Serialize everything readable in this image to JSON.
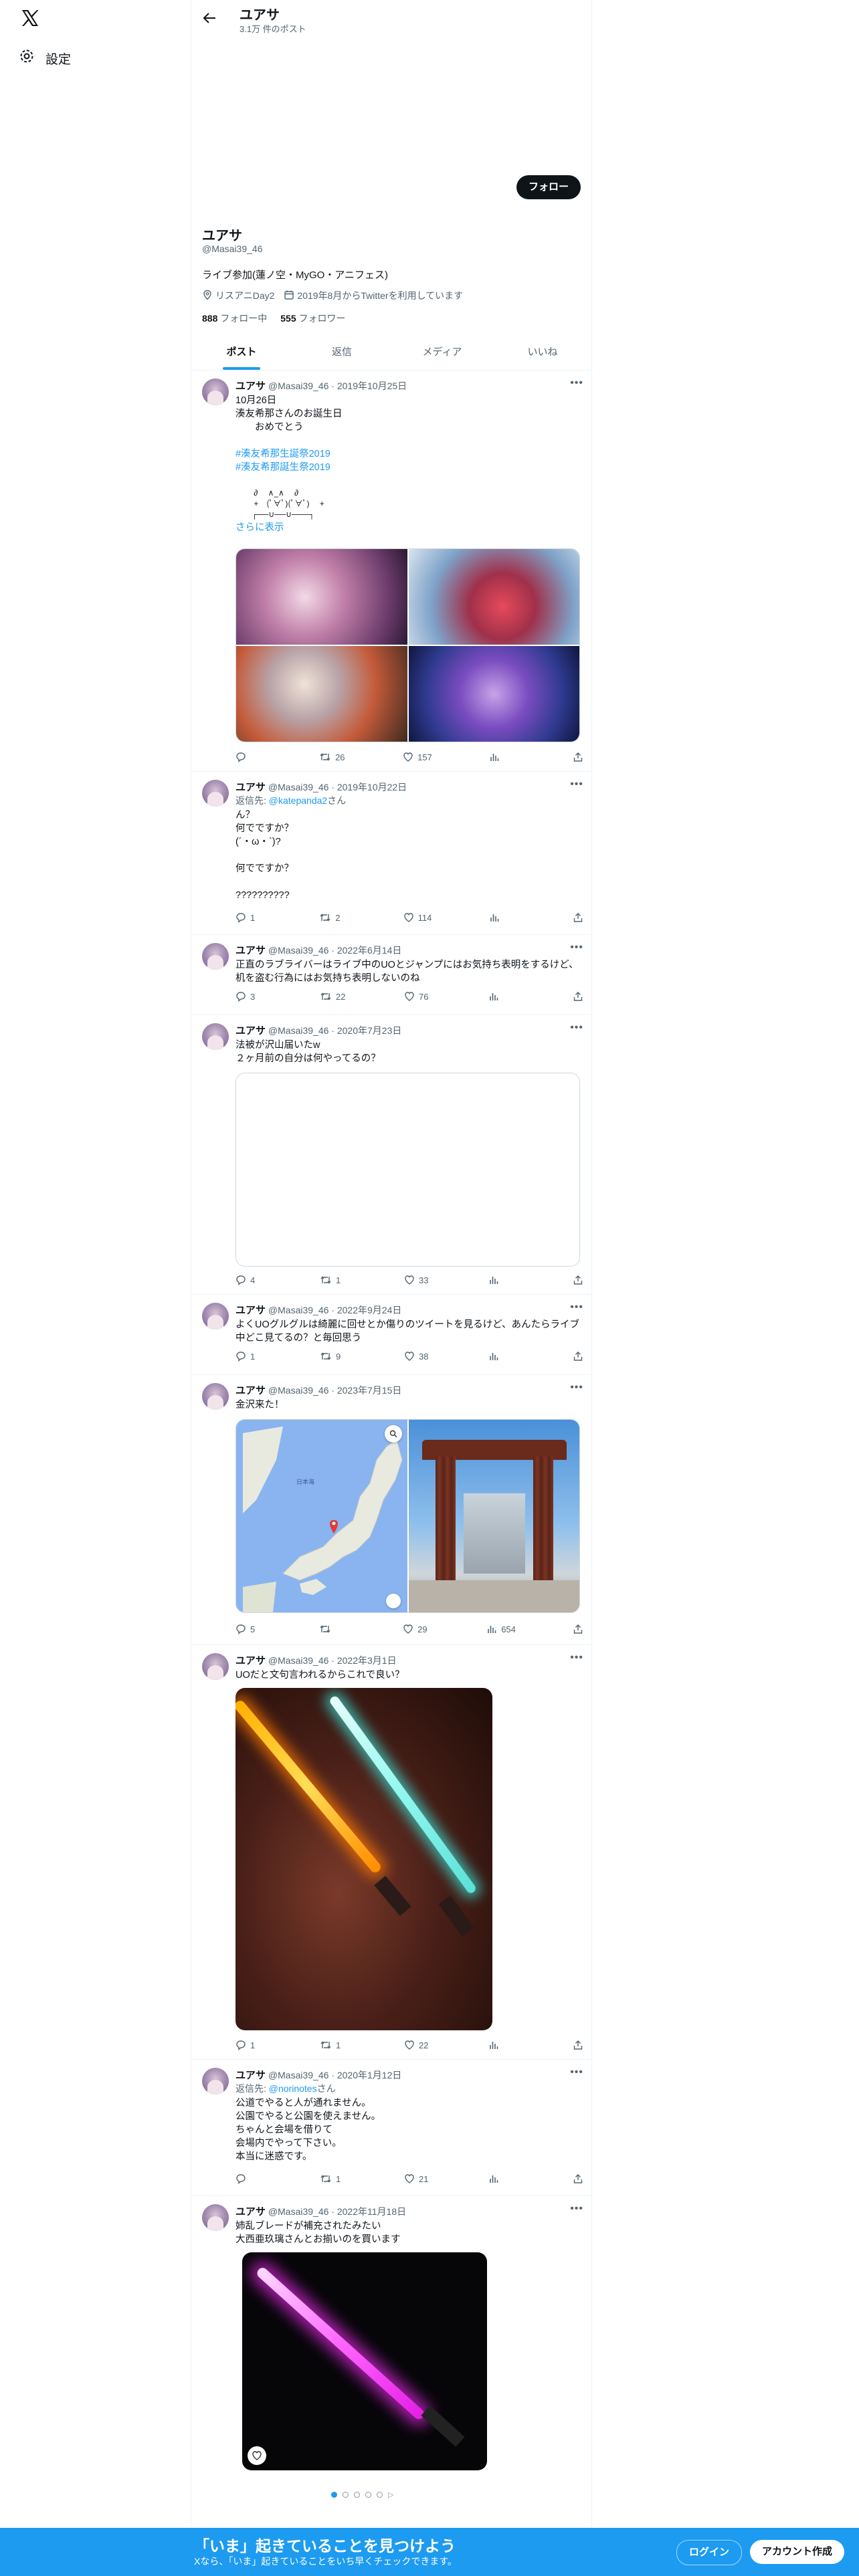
{
  "sidebar": {
    "settings_label": "設定"
  },
  "topbar": {
    "name": "ユアサ",
    "post_count": "3.1万 件のポスト"
  },
  "profile": {
    "follow_label": "フォロー",
    "name": "ユアサ",
    "handle": "@Masai39_46",
    "bio": "ライブ参加(蓮ノ空・MyGO・アニフェス)",
    "location": "リスアニDay2",
    "joined": "2019年8月からTwitterを利用しています",
    "following_count": "888",
    "following_label": "フォロー中",
    "followers_count": "555",
    "followers_label": "フォロワー"
  },
  "tabs": [
    "ポスト",
    "返信",
    "メディア",
    "いいね"
  ],
  "tweets": [
    {
      "name": "ユアサ",
      "handle": "@Masai39_46",
      "date": "2019年10月25日",
      "text": "10月26日\n湊友希那さんのお誕生日\n　　おめでとう",
      "hashtags": [
        "#湊友希那生誕祭2019",
        "#湊友希那誕生祭2019"
      ],
      "art": "　　 ∂　 ∧_∧ 　∂\n　　 +　(ﾟ∀ﾟ)(ﾟ∀ﾟ) 　+\n　　┌──∪──∪───┐",
      "show_more": "さらに表示",
      "reply": "",
      "retweet": "26",
      "like": "157",
      "views": ""
    },
    {
      "name": "ユアサ",
      "handle": "@Masai39_46",
      "date": "2019年10月22日",
      "reply_prefix": "返信先:",
      "reply_to": "@katepanda2",
      "reply_suffix": "さん",
      "text": "ん？\n何でですか？\n(´・ω・`)?\n\n何でですか？\n\n??????????",
      "reply": "1",
      "retweet": "2",
      "like": "114",
      "views": ""
    },
    {
      "name": "ユアサ",
      "handle": "@Masai39_46",
      "date": "2022年6月14日",
      "text": "正直のラブライバーはライブ中のUOとジャンプにはお気持ち表明をするけど、机を盗む行為にはお気持ち表明しないのね",
      "reply": "3",
      "retweet": "22",
      "like": "76",
      "views": ""
    },
    {
      "name": "ユアサ",
      "handle": "@Masai39_46",
      "date": "2020年7月23日",
      "text": "法被が沢山届いたw\n２ヶ月前の自分は何やってるの？",
      "reply": "4",
      "retweet": "1",
      "like": "33",
      "views": ""
    },
    {
      "name": "ユアサ",
      "handle": "@Masai39_46",
      "date": "2022年9月24日",
      "text": "よくUOグルグルは綺麗に回せとか傷りのツイートを見るけど、あんたらライブ中どこ見てるの？と毎回思う",
      "reply": "1",
      "retweet": "9",
      "like": "38",
      "views": ""
    },
    {
      "name": "ユアサ",
      "handle": "@Masai39_46",
      "date": "2023年7月15日",
      "text": "金沢来た！",
      "reply": "5",
      "retweet": "",
      "like": "29",
      "views": "654"
    },
    {
      "name": "ユアサ",
      "handle": "@Masai39_46",
      "date": "2022年3月1日",
      "text": "UOだと文句言われるからこれで良い？",
      "reply": "1",
      "retweet": "1",
      "like": "22",
      "views": ""
    },
    {
      "name": "ユアサ",
      "handle": "@Masai39_46",
      "date": "2020年1月12日",
      "reply_prefix": "返信先:",
      "reply_to": "@norinotes",
      "reply_suffix": "さん",
      "text": "公道でやると人が通れません。\n公園でやると公園を使えません。\nちゃんと会場を借りて\n会場内でやって下さい。\n本当に迷惑です。",
      "reply": "",
      "retweet": "1",
      "like": "21",
      "views": ""
    },
    {
      "name": "ユアサ",
      "handle": "@Masai39_46",
      "date": "2022年11月18日",
      "text": "姉乱ブレードが補充されたみたい\n大西亜玖璃さんとお揃いのを買います",
      "reply": "",
      "retweet": "",
      "like": "",
      "views": ""
    }
  ],
  "map": {
    "sea_label": "日本海"
  },
  "signup": {
    "title": "「いま」起きていることを見つけよう",
    "subtitle": "Xなら、「いま」起きていることをいち早くチェックできます。",
    "login": "ログイン",
    "create": "アカウント作成"
  }
}
